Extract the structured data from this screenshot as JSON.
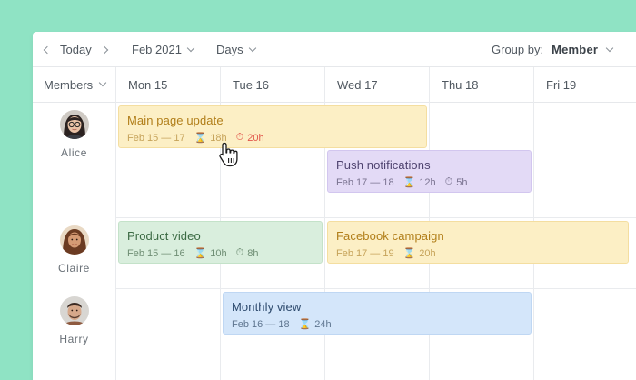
{
  "toolbar": {
    "today_label": "Today",
    "period_label": "Feb 2021",
    "view_label": "Days",
    "groupby_label": "Group by:",
    "groupby_value": "Member"
  },
  "header": {
    "members_label": "Members",
    "days": [
      "Mon 15",
      "Tue 16",
      "Wed 17",
      "Thu 18",
      "Fri 19"
    ]
  },
  "members": [
    {
      "name": "Alice"
    },
    {
      "name": "Claire"
    },
    {
      "name": "Harry"
    }
  ],
  "tasks": [
    {
      "title": "Main page update",
      "dates": "Feb 15 — 17",
      "estimate": "18h",
      "tracked": "20h",
      "over_budget": true,
      "color": "#fcefc5"
    },
    {
      "title": "Push notifications",
      "dates": "Feb 17 — 18",
      "estimate": "12h",
      "tracked": "5h",
      "over_budget": false,
      "color": "#e3daf6"
    },
    {
      "title": "Product video",
      "dates": "Feb 15 — 16",
      "estimate": "10h",
      "tracked": "8h",
      "over_budget": false,
      "color": "#d9eedd"
    },
    {
      "title": "Facebook campaign",
      "dates": "Feb 17 — 19",
      "estimate": "20h",
      "color": "#fcefc5"
    },
    {
      "title": "Monthly view",
      "dates": "Feb 16 — 18",
      "estimate": "24h",
      "color": "#d4e6fa"
    }
  ],
  "colors": {
    "background": "#8fe3c4",
    "over_budget": "#e2574b"
  }
}
